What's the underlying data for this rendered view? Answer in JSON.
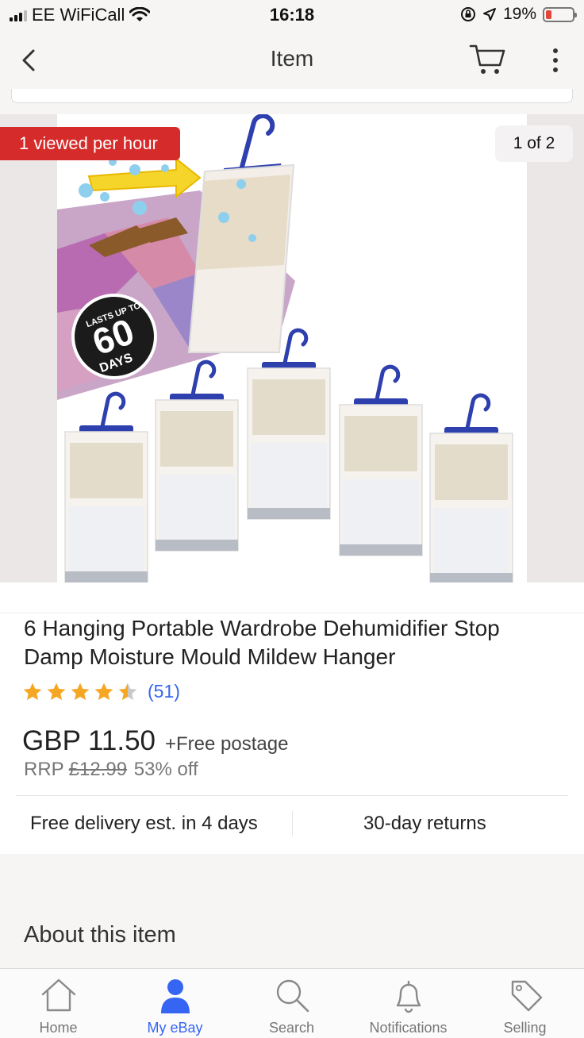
{
  "status_bar": {
    "carrier": "EE WiFiCall",
    "time": "16:18",
    "battery_percent": "19%"
  },
  "nav": {
    "title": "Item"
  },
  "image": {
    "views_badge": "1 viewed per hour",
    "page_counter": "1 of 2",
    "badge_text_top": "LASTS UP TO",
    "badge_text_number": "60",
    "badge_text_bottom": "DAYS"
  },
  "item": {
    "title": "6 Hanging Portable Wardrobe Dehumidifier Stop Damp Moisture Mould Mildew Hanger",
    "rating_stars": 4.5,
    "review_count": "(51)",
    "price": "GBP 11.50",
    "postage": "+Free postage",
    "rrp_label": "RRP",
    "rrp_price": "£12.99",
    "discount": "53% off",
    "delivery": "Free delivery est. in 4 days",
    "returns": "30-day returns"
  },
  "sections": {
    "about_heading": "About this item"
  },
  "tabs": [
    {
      "label": "Home",
      "icon": "home-icon"
    },
    {
      "label": "My eBay",
      "icon": "person-icon"
    },
    {
      "label": "Search",
      "icon": "search-icon"
    },
    {
      "label": "Notifications",
      "icon": "bell-icon"
    },
    {
      "label": "Selling",
      "icon": "tag-icon"
    }
  ],
  "colors": {
    "accent_blue": "#3665f3",
    "badge_red": "#d62b2b",
    "star_orange": "#f5a623",
    "hanger_blue": "#2e3fae"
  }
}
